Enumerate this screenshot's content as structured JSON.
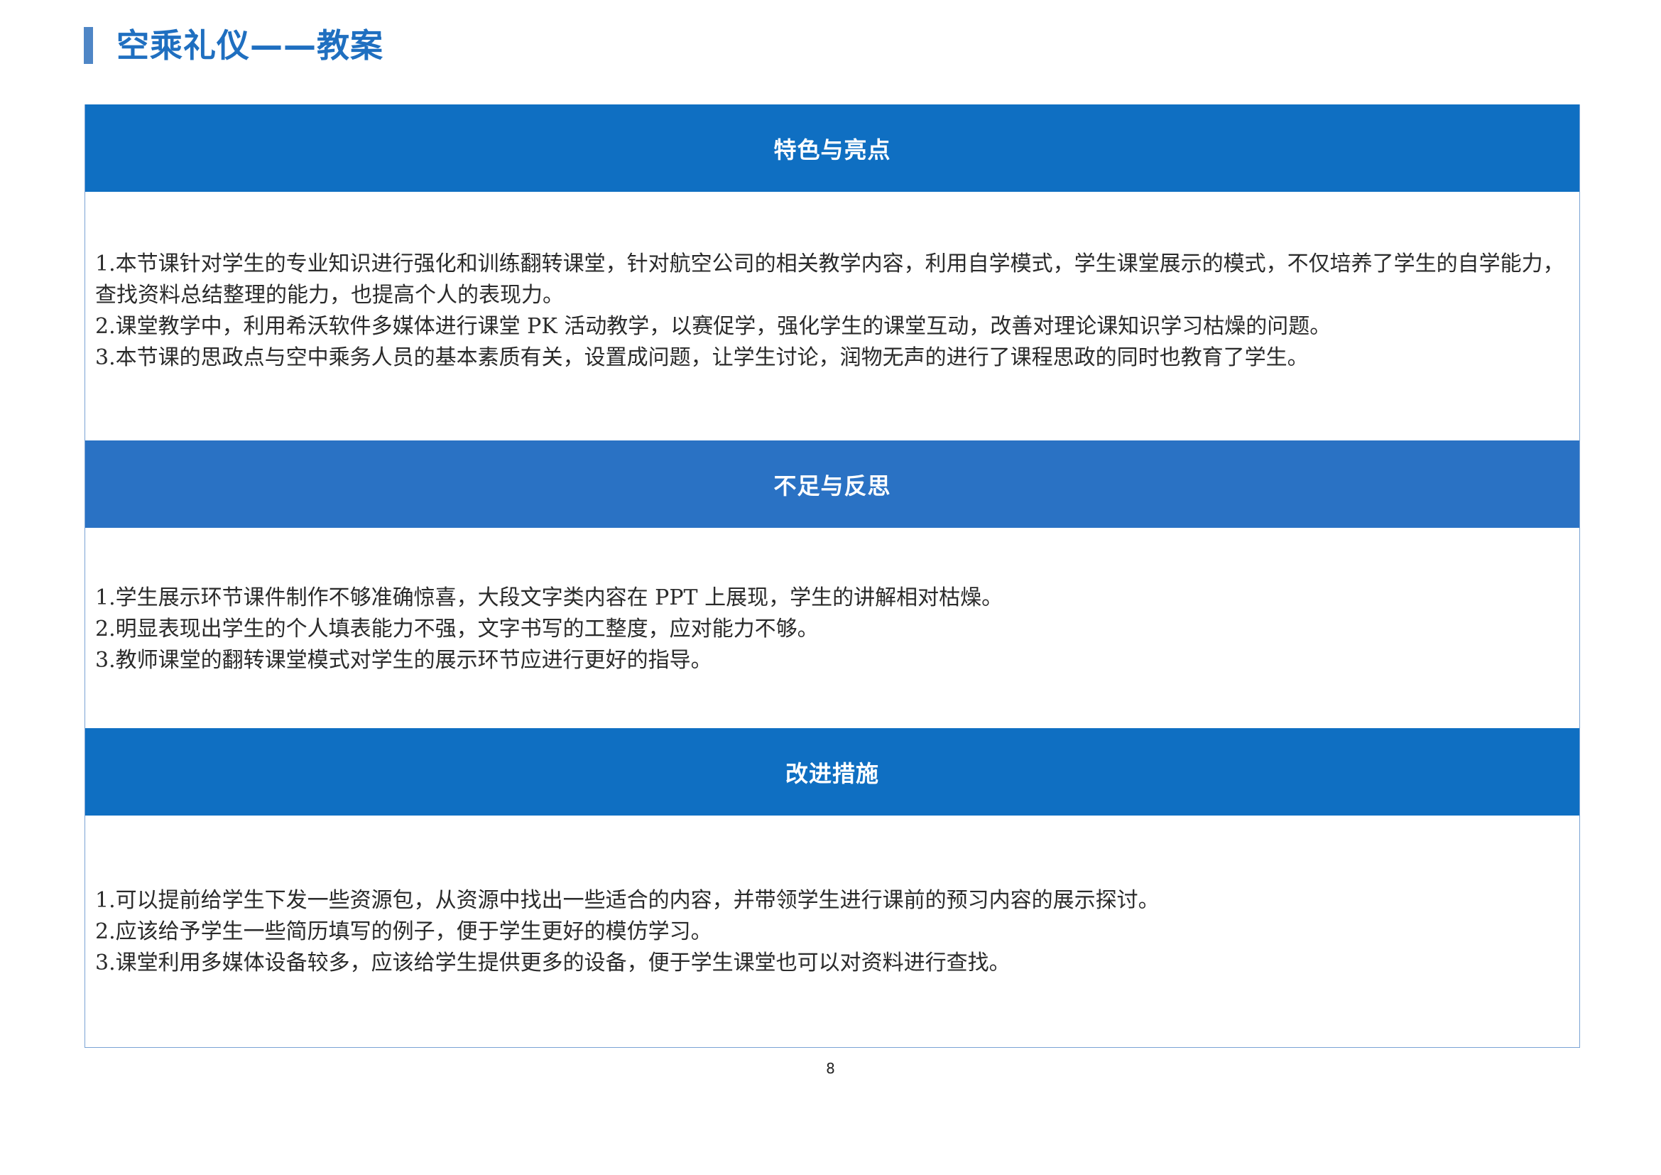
{
  "document": {
    "title": "空乘礼仪——教案",
    "page_number": "8"
  },
  "sections": [
    {
      "heading": "特色与亮点",
      "items": [
        "1.本节课针对学生的专业知识进行强化和训练翻转课堂，针对航空公司的相关教学内容，利用自学模式，学生课堂展示的模式，不仅培养了学生的自学能力，查找资料总结整理的能力，也提高个人的表现力。",
        "2.课堂教学中，利用希沃软件多媒体进行课堂 PK 活动教学，以赛促学，强化学生的课堂互动，改善对理论课知识学习枯燥的问题。",
        "3.本节课的思政点与空中乘务人员的基本素质有关，设置成问题，让学生讨论，润物无声的进行了课程思政的同时也教育了学生。"
      ]
    },
    {
      "heading": "不足与反思",
      "items": [
        "1.学生展示环节课件制作不够准确惊喜，大段文字类内容在 PPT 上展现，学生的讲解相对枯燥。",
        "2.明显表现出学生的个人填表能力不强，文字书写的工整度，应对能力不够。",
        "3.教师课堂的翻转课堂模式对学生的展示环节应进行更好的指导。"
      ]
    },
    {
      "heading": "改进措施",
      "items": [
        "1.可以提前给学生下发一些资源包，从资源中找出一些适合的内容，并带领学生进行课前的预习内容的展示探讨。",
        "2.应该给予学生一些简历填写的例子，便于学生更好的模仿学习。",
        "3.课堂利用多媒体设备较多，应该给学生提供更多的设备，便于学生课堂也可以对资料进行查找。"
      ]
    }
  ]
}
